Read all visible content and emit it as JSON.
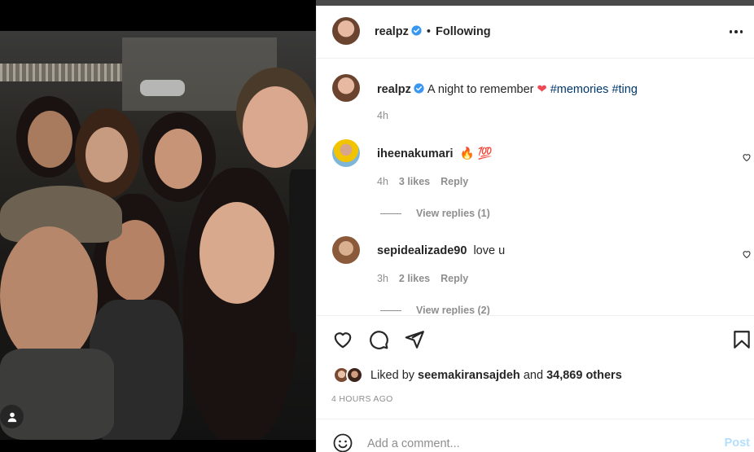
{
  "post": {
    "author": "realpz",
    "follow_state": "Following",
    "separator": "•",
    "caption": {
      "username": "realpz",
      "text": "A night to remember",
      "hashtags": "#memories #ting",
      "time": "4h"
    },
    "comments": [
      {
        "username": "iheenakumari",
        "text": "🔥 💯",
        "time": "4h",
        "likes": "3 likes",
        "reply_label": "Reply",
        "view_replies": "View replies (1)"
      },
      {
        "username": "sepidealizade90",
        "text": "love u",
        "time": "3h",
        "likes": "2 likes",
        "reply_label": "Reply",
        "view_replies": "View replies (2)"
      }
    ],
    "liked_by": {
      "prefix": "Liked by",
      "user": "seemakiransajdeh",
      "and": "and",
      "others": "34,869 others"
    },
    "posted_ago": "4 HOURS AGO",
    "comment_box": {
      "placeholder": "Add a comment...",
      "post_label": "Post"
    }
  },
  "colors": {
    "verified": "#3897f0",
    "hashtag": "#00376b",
    "muted": "#8e8e8e",
    "post_disabled": "#b2dffc",
    "heart": "#ed4956"
  },
  "icons": [
    "verified-badge-icon",
    "more-options-icon",
    "heart-icon",
    "comment-icon",
    "share-icon",
    "bookmark-icon",
    "emoji-icon",
    "user-icon"
  ]
}
